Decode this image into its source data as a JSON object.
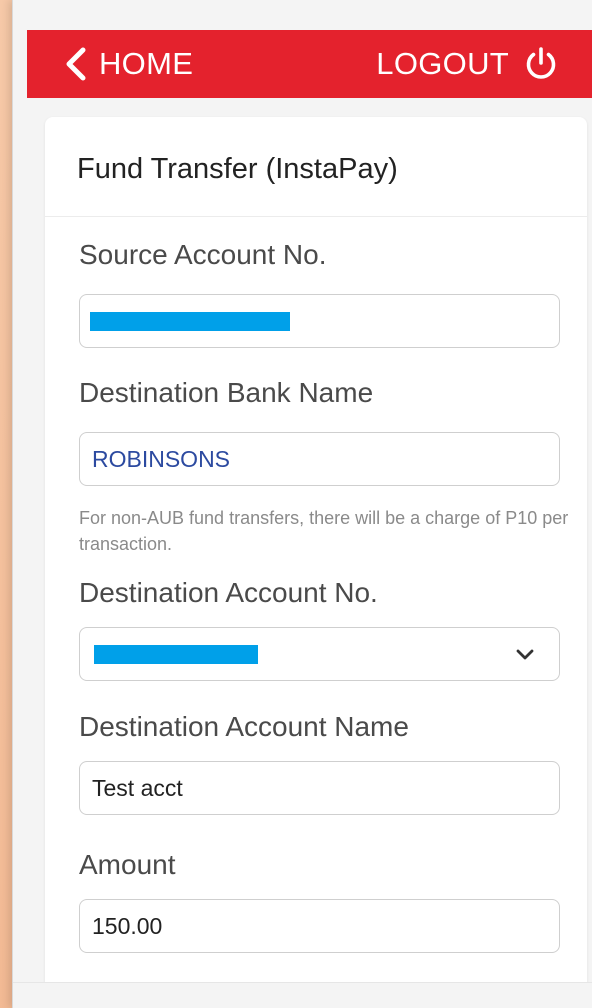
{
  "nav": {
    "home_label": "HOME",
    "logout_label": "LOGOUT"
  },
  "colors": {
    "brand_red": "#e4222d",
    "redaction_blue": "#00a0e9",
    "bank_text_blue": "#2c4aa0"
  },
  "icons": {
    "back": "chevron-left-icon",
    "logout": "power-icon",
    "select": "chevron-down-icon"
  },
  "form": {
    "title": "Fund Transfer (InstaPay)",
    "source_account": {
      "label": "Source Account No.",
      "value": ""
    },
    "destination_bank": {
      "label": "Destination Bank Name",
      "value": "ROBINSONS",
      "note": "For non-AUB fund transfers, there will be a charge of P10 per transaction."
    },
    "destination_account": {
      "label": "Destination Account No.",
      "value": ""
    },
    "destination_account_name": {
      "label": "Destination Account Name",
      "value": "Test acct"
    },
    "amount": {
      "label": "Amount",
      "value": "150.00"
    }
  }
}
